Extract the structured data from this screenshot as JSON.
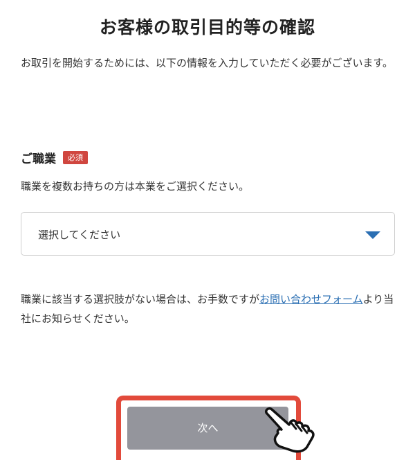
{
  "page": {
    "title": "お客様の取引目的等の確認",
    "intro": "お取引を開始するためには、以下の情報を入力していただく必要がございます。"
  },
  "occupation": {
    "label": "ご職業",
    "required_badge": "必須",
    "hint": "職業を複数お持ちの方は本業をご選択ください。",
    "select_placeholder": "選択してください"
  },
  "note": {
    "before_link": "職業に該当する選択肢がない場合は、お手数ですが",
    "link_text": "お問い合わせフォーム",
    "after_link": "より当社にお知らせください。"
  },
  "footer": {
    "next_button": "次へ"
  },
  "colors": {
    "badge": "#d0463f",
    "link": "#2b6fb3",
    "button": "#94959c",
    "highlight": "#e24a3b"
  },
  "icons": {
    "pointer": "pointing-hand-icon",
    "dropdown": "chevron-down-icon"
  }
}
